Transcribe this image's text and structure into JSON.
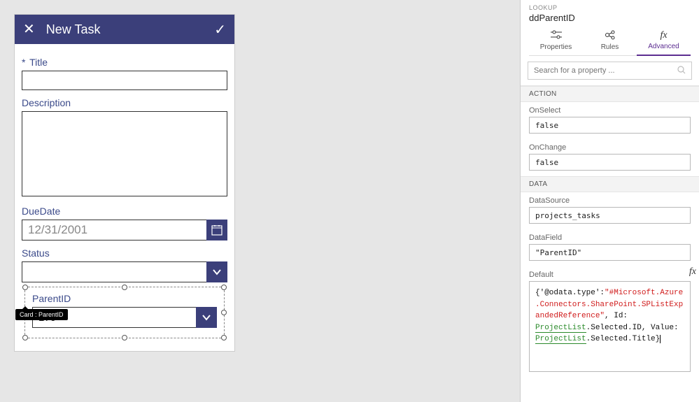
{
  "form": {
    "header_title": "New Task",
    "fields": {
      "title": {
        "label": "Title",
        "required_mark": "*",
        "value": ""
      },
      "description": {
        "label": "Description",
        "value": ""
      },
      "duedate": {
        "label": "DueDate",
        "value": "12/31/2001"
      },
      "status": {
        "label": "Status",
        "value": ""
      },
      "parentid": {
        "label": "ParentID",
        "value": "170"
      }
    },
    "tooltip": "Card : ParentID"
  },
  "panel": {
    "kind_label": "LOOKUP",
    "control_name": "ddParentID",
    "tabs": {
      "properties": "Properties",
      "rules": "Rules",
      "advanced": "Advanced"
    },
    "search_placeholder": "Search for a property ...",
    "sections": {
      "action": "ACTION",
      "data": "DATA"
    },
    "props": {
      "onselect": {
        "label": "OnSelect",
        "value": "false"
      },
      "onchange": {
        "label": "OnChange",
        "value": "false"
      },
      "datasource": {
        "label": "DataSource",
        "value": "projects_tasks"
      },
      "datafield": {
        "label": "DataField",
        "value": "\"ParentID\""
      },
      "default": {
        "label": "Default",
        "formula_tokens": [
          {
            "t": "br",
            "v": "{"
          },
          {
            "t": "plain",
            "v": "'@odata.type':"
          },
          {
            "t": "str",
            "v": "\"#Microsoft.Azure.Connectors.SharePoint.SPListExpandedReference\""
          },
          {
            "t": "plain",
            "v": ", Id:"
          },
          {
            "t": "ref",
            "v": "ProjectList"
          },
          {
            "t": "plain",
            "v": ".Selected.ID, Value:"
          },
          {
            "t": "ref",
            "v": "ProjectList"
          },
          {
            "t": "plain",
            "v": ".Selected.Title"
          },
          {
            "t": "br",
            "v": "}"
          }
        ]
      }
    }
  }
}
